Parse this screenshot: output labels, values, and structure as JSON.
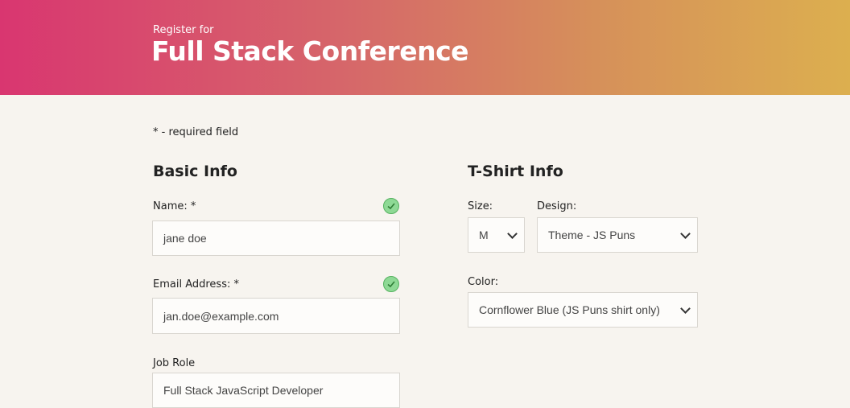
{
  "header": {
    "pre_title": "Register for",
    "title": "Full Stack Conference"
  },
  "required_note": "* - required field",
  "basic_info": {
    "title": "Basic Info",
    "name_label": "Name: *",
    "name_value": "jane doe",
    "email_label": "Email Address: *",
    "email_value": "jan.doe@example.com",
    "job_label": "Job Role",
    "job_value": "Full Stack JavaScript Developer"
  },
  "tshirt": {
    "title": "T-Shirt Info",
    "size_label": "Size:",
    "size_value": "M",
    "design_label": "Design:",
    "design_value": "Theme - JS Puns",
    "color_label": "Color:",
    "color_value": "Cornflower Blue (JS Puns shirt only)"
  },
  "icons": {
    "valid": "check-circle-icon",
    "dropdown": "chevron-down-icon"
  },
  "colors": {
    "gradient_start": "#d93670",
    "gradient_end": "#dcaf4f",
    "valid_green": "#8ed995"
  }
}
